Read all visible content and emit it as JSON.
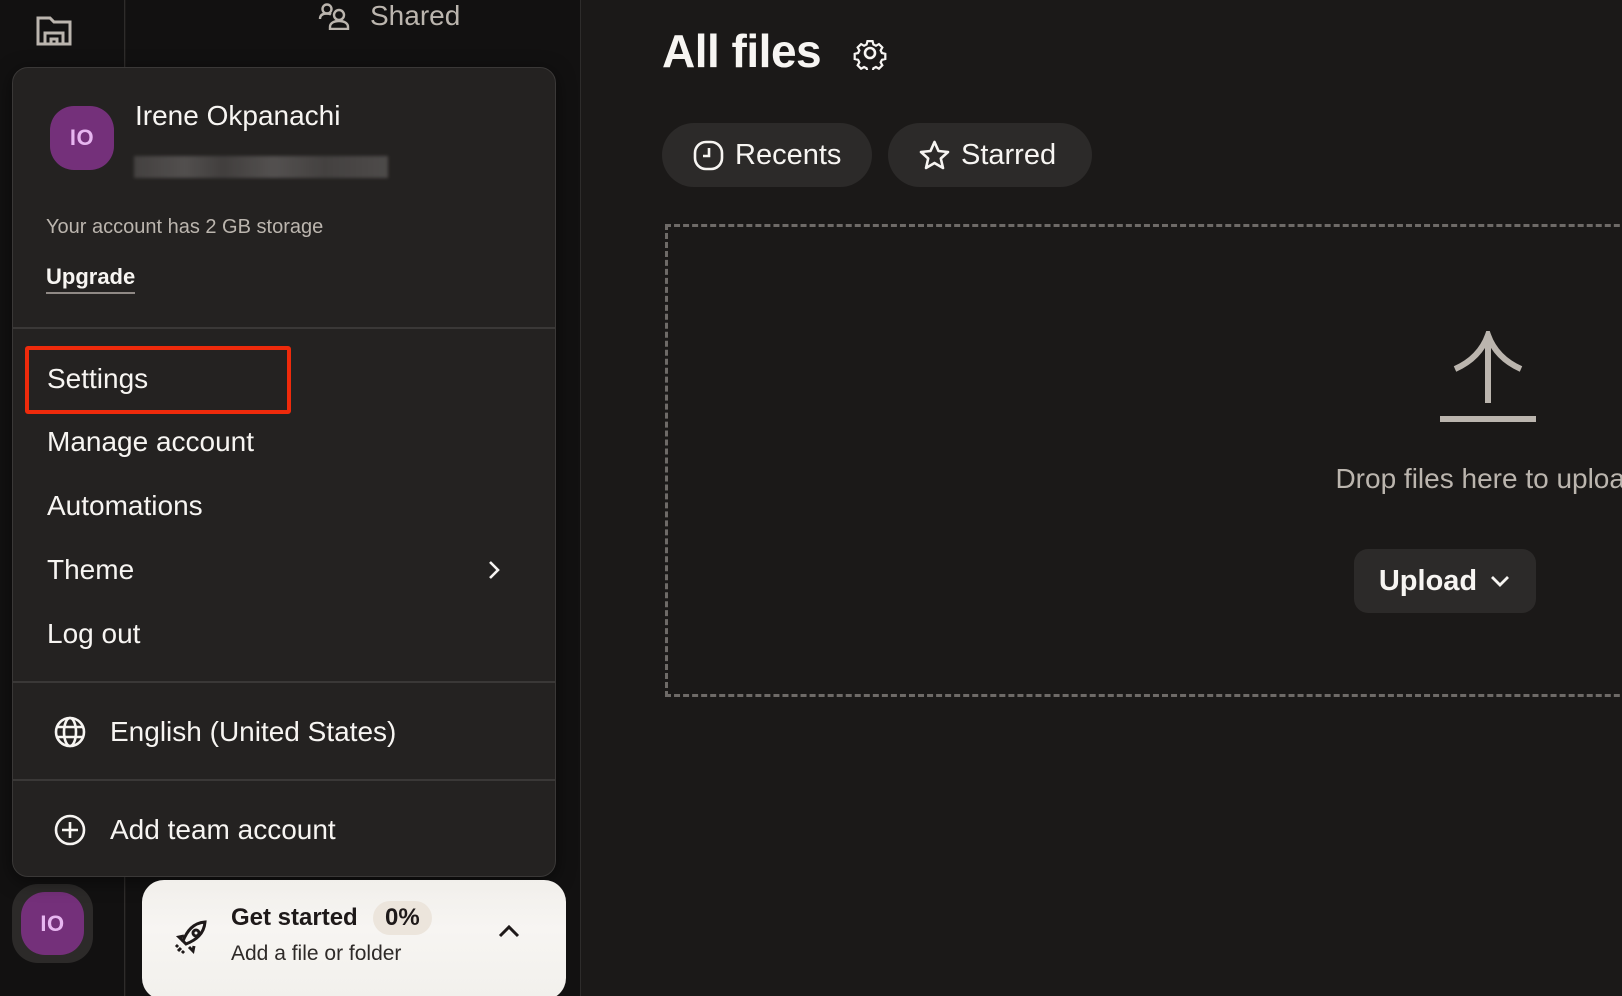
{
  "rail": {
    "folder_icon": "folder-icon",
    "avatar_initials": "IO"
  },
  "sidebar": {
    "shared_label": "Shared",
    "shared_icon": "people-icon"
  },
  "account_menu": {
    "user_name": "Irene Okpanachi",
    "avatar_initials": "IO",
    "email_redacted": true,
    "storage_text": "Your account has 2 GB storage",
    "upgrade_label": "Upgrade",
    "items": [
      {
        "label": "Settings",
        "highlighted": true
      },
      {
        "label": "Manage account"
      },
      {
        "label": "Automations"
      },
      {
        "label": "Theme",
        "has_submenu": true
      },
      {
        "label": "Log out"
      }
    ],
    "language": {
      "label": "English (United States)",
      "icon": "globe-icon"
    },
    "add_team": {
      "label": "Add team account",
      "icon": "plus-circle-icon"
    }
  },
  "get_started": {
    "title": "Get started",
    "progress": "0%",
    "subtitle": "Add a file or folder",
    "icon": "rocket-icon"
  },
  "main": {
    "title": "All files",
    "filters": [
      {
        "label": "Recents",
        "icon": "clock-icon"
      },
      {
        "label": "Starred",
        "icon": "star-icon"
      }
    ],
    "dropzone": {
      "text": "Drop files here to upload",
      "upload_label": "Upload"
    }
  },
  "colors": {
    "highlight": "#ee2a0b",
    "avatar_bg": "#74307a",
    "avatar_text": "#e7b6f0",
    "background": "#1b1918",
    "panel": "#242221"
  }
}
